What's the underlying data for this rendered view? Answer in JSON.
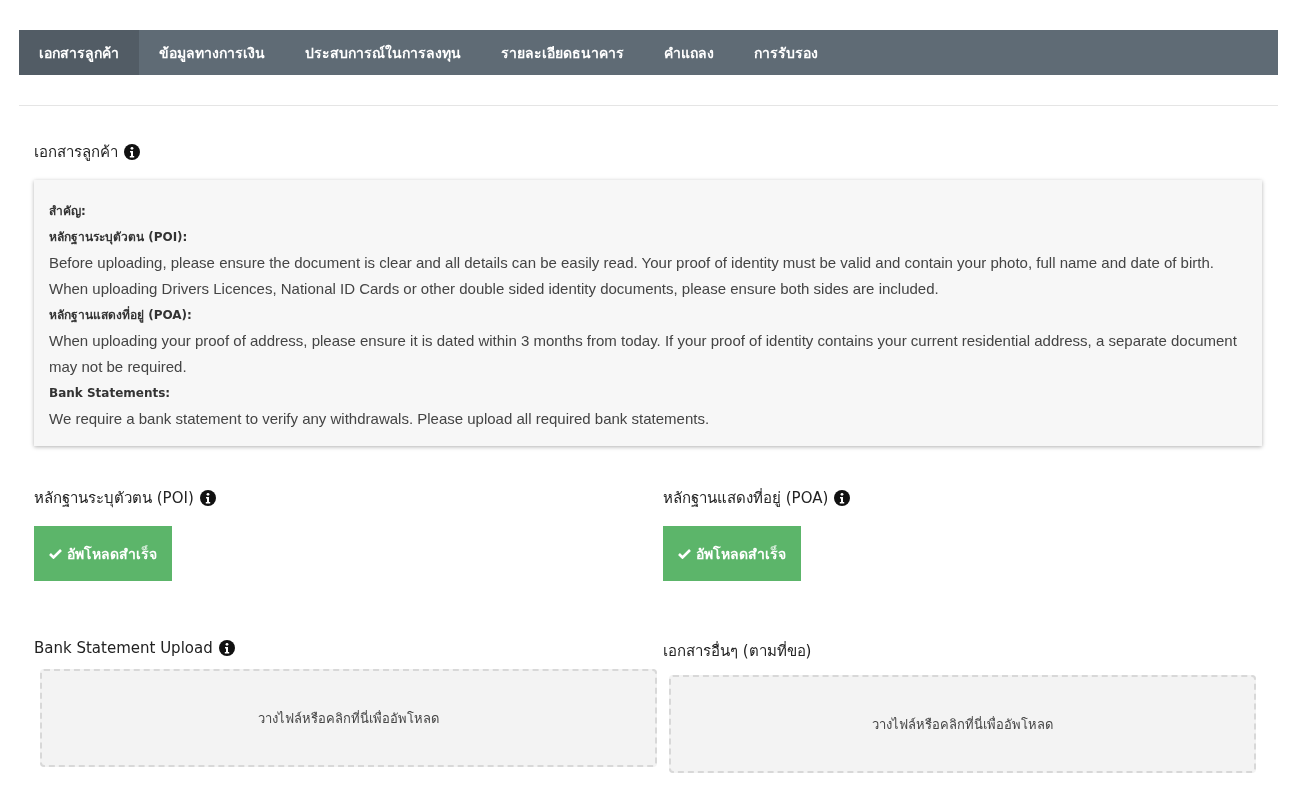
{
  "tabs": [
    {
      "label": "เอกสารลูกค้า",
      "selected": true
    },
    {
      "label": "ข้อมูลทางการเงิน",
      "selected": false
    },
    {
      "label": "ประสบการณ์ในการลงทุน",
      "selected": false
    },
    {
      "label": "รายละเอียดธนาคาร",
      "selected": false
    },
    {
      "label": "คำแถลง",
      "selected": false
    },
    {
      "label": "การรับรอง",
      "selected": false
    }
  ],
  "page_title": {
    "text": "เอกสารลูกค้า",
    "info": true
  },
  "notice": [
    {
      "kind": "heading",
      "text": "สำคัญ:"
    },
    {
      "kind": "heading",
      "text": "หลักฐานระบุตัวตน (POI):"
    },
    {
      "kind": "text",
      "text": "Before uploading, please ensure the document is clear and all details can be easily read. Your proof of identity must be valid and contain your photo, full name and date of birth. When uploading Drivers Licences, National ID Cards or other double sided identity documents, please ensure both sides are included."
    },
    {
      "kind": "heading",
      "text": "หลักฐานแสดงที่อยู่ (POA):"
    },
    {
      "kind": "text",
      "text": "When uploading your proof of address, please ensure it is dated within 3 months from today. If your proof of identity contains your current residential address, a separate document may not be required."
    },
    {
      "kind": "heading",
      "text": "Bank Statements:"
    },
    {
      "kind": "text",
      "text": "We require a bank statement to verify any withdrawals. Please upload all required bank statements."
    }
  ],
  "sections": [
    {
      "title": "หลักฐานระบุตัวตน (POI)",
      "info": true,
      "kind": "uploaded",
      "label": "อัพโหลดสำเร็จ"
    },
    {
      "title": "หลักฐานแสดงที่อยู่ (POA)",
      "info": true,
      "kind": "uploaded",
      "label": "อัพโหลดสำเร็จ"
    },
    {
      "title": "Bank Statement Upload",
      "info": true,
      "kind": "dropzone",
      "label": "วางไฟล์หรือคลิกที่นี่เพื่ออัพโหลด"
    },
    {
      "title": "เอกสารอื่นๆ (ตามที่ขอ)",
      "info": false,
      "kind": "dropzone",
      "label": "วางไฟล์หรือคลิกที่นี่เพื่ออัพโหลด"
    }
  ]
}
